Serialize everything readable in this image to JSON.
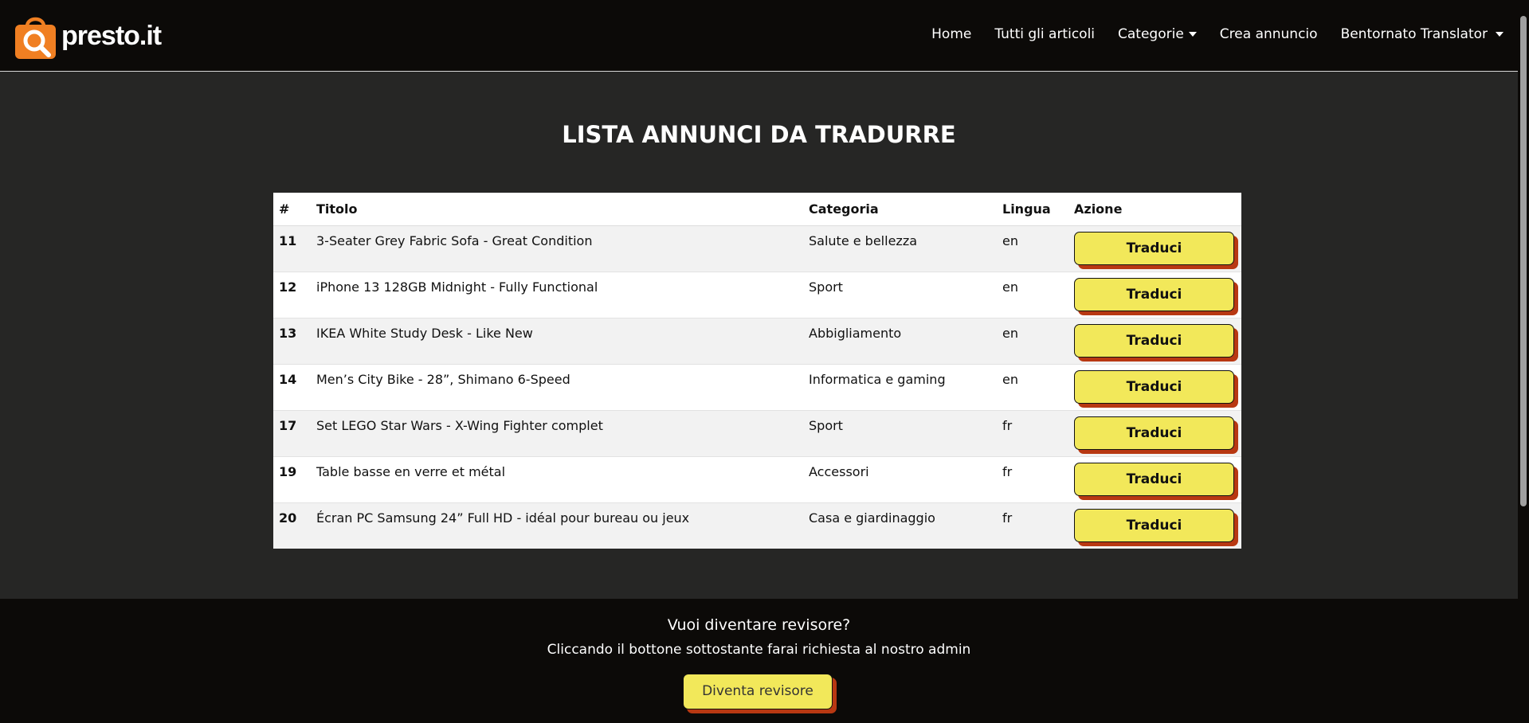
{
  "nav": {
    "brand": "presto.it",
    "links": {
      "home": "Home",
      "all_items": "Tutti gli articoli",
      "categories": "Categorie",
      "create_ad": "Crea annuncio",
      "user": "Bentornato Translator"
    }
  },
  "main": {
    "title": "LISTA ANNUNCI DA TRADURRE",
    "table": {
      "headers": {
        "num": "#",
        "title": "Titolo",
        "category": "Categoria",
        "language": "Lingua",
        "action": "Azione"
      },
      "rows": [
        {
          "id": "11",
          "title": "3-Seater Grey Fabric Sofa - Great Condition",
          "category": "Salute e bellezza",
          "language": "en",
          "action": "Traduci"
        },
        {
          "id": "12",
          "title": "iPhone 13 128GB Midnight - Fully Functional",
          "category": "Sport",
          "language": "en",
          "action": "Traduci"
        },
        {
          "id": "13",
          "title": "IKEA White Study Desk - Like New",
          "category": "Abbigliamento",
          "language": "en",
          "action": "Traduci"
        },
        {
          "id": "14",
          "title": "Men’s City Bike - 28”, Shimano 6-Speed",
          "category": "Informatica e gaming",
          "language": "en",
          "action": "Traduci"
        },
        {
          "id": "17",
          "title": "Set LEGO Star Wars - X-Wing Fighter complet",
          "category": "Sport",
          "language": "fr",
          "action": "Traduci"
        },
        {
          "id": "19",
          "title": "Table basse en verre et métal",
          "category": "Accessori",
          "language": "fr",
          "action": "Traduci"
        },
        {
          "id": "20",
          "title": "Écran PC Samsung 24” Full HD - idéal pour bureau ou jeux",
          "category": "Casa e giardinaggio",
          "language": "fr",
          "action": "Traduci"
        }
      ]
    }
  },
  "footer": {
    "title": "Vuoi diventare revisore?",
    "text": "Cliccando il bottone sottostante farai richiesta al nostro admin",
    "button": "Diventa revisore"
  },
  "colors": {
    "nav_bg": "#0c0a08",
    "page_bg": "#262625",
    "accent_orange": "#f07f22",
    "button_yellow": "#f2e85a",
    "button_shadow": "#b83812"
  },
  "icons": {
    "logo": "shopping-bag-search-icon",
    "dropdown": "caret-down-icon"
  }
}
